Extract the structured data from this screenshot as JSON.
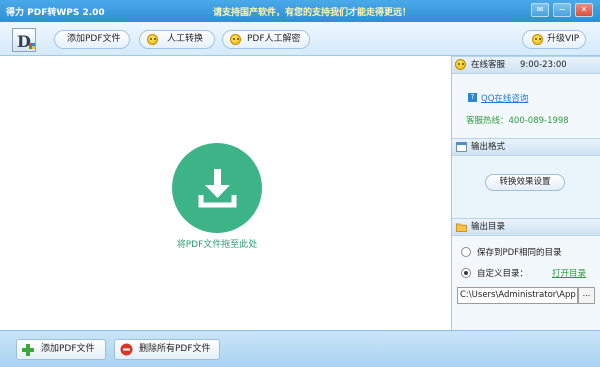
{
  "window": {
    "title": "得力 PDF转WPS 2.00",
    "slogan": "请支持国产软件，有您的支持我们才能走得更远！",
    "buttons": {
      "skin": "✉",
      "minimize": "−",
      "close": "✕"
    }
  },
  "toolbar": {
    "add_pdf": "添加PDF文件",
    "manual_convert": "人工转换",
    "pdf_decrypt": "PDF人工解密",
    "upgrade_vip": "升级VIP"
  },
  "droparea": {
    "hint": "将PDF文件拖至此处",
    "icon": "download-icon"
  },
  "sidepanel": {
    "service": {
      "header": "在线客服",
      "hours": "9:00-23:00",
      "qq_badge": "?",
      "qq_link": "QQ在线咨询",
      "hotline": "客服热线：400-089-1998"
    },
    "format": {
      "header": "输出格式",
      "settings_button": "转换效果设置"
    },
    "output": {
      "header": "输出目录",
      "option_same": "保存到PDF相同的目录",
      "option_custom": "自定义目录：",
      "open_dir": "打开目录",
      "path": "C:\\Users\\Administrator\\App",
      "browse": "..."
    }
  },
  "bottombar": {
    "add_pdf": "添加PDF文件",
    "delete_all": "删除所有PDF文件"
  },
  "colors": {
    "titlebar": "#2f8fd6",
    "accent_green": "#3db388",
    "hotline_green": "#2f9a3c",
    "link_blue": "#1f7ad0"
  }
}
